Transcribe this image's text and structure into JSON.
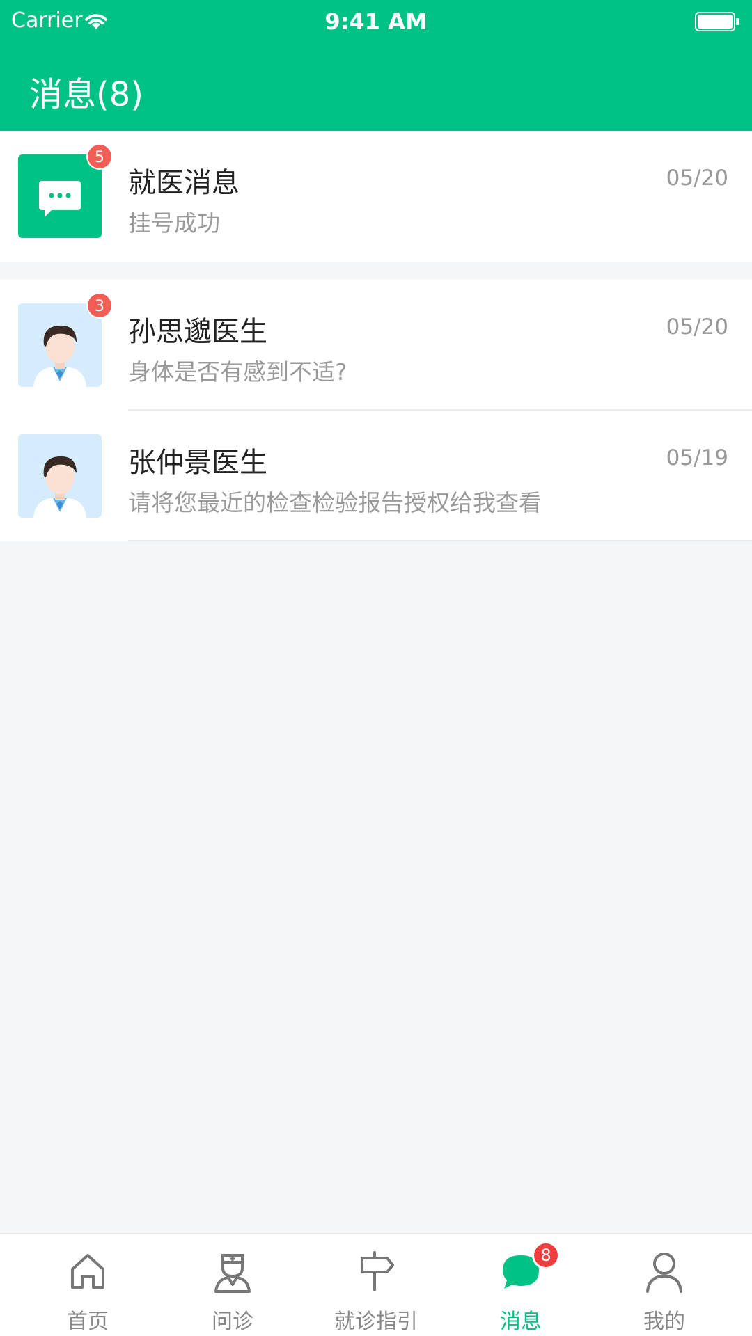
{
  "status_bar": {
    "carrier": "Carrier",
    "time": "9:41 AM"
  },
  "header": {
    "title": "消息(8)"
  },
  "messages": [
    {
      "title": "就医消息",
      "subtitle": "挂号成功",
      "date": "05/20",
      "badge": "5",
      "avatar": "chat-bubble-icon"
    },
    {
      "title": "孙思邈医生",
      "subtitle": "身体是否有感到不适?",
      "date": "05/20",
      "badge": "3",
      "avatar": "doctor-avatar"
    },
    {
      "title": "张仲景医生",
      "subtitle": "请将您最近的检查检验报告授权给我查看",
      "date": "05/19",
      "badge": "",
      "avatar": "doctor-avatar"
    }
  ],
  "tabbar": {
    "tabs": [
      {
        "label": "首页",
        "icon": "home-icon"
      },
      {
        "label": "问诊",
        "icon": "nurse-icon"
      },
      {
        "label": "就诊指引",
        "icon": "signpost-icon"
      },
      {
        "label": "消息",
        "icon": "message-icon",
        "badge": "8",
        "active": true
      },
      {
        "label": "我的",
        "icon": "user-icon"
      }
    ]
  },
  "colors": {
    "brand": "#00c284",
    "badge": "#f25d55",
    "tab_badge": "#f03e3e"
  }
}
